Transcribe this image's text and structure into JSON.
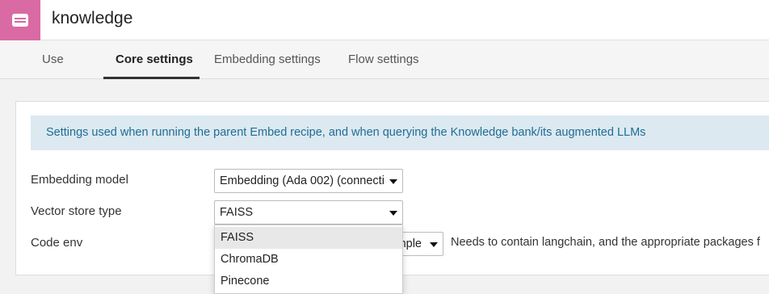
{
  "header": {
    "icon": "dataset-icon",
    "accent_color": "#d96aa4",
    "title": "knowledge"
  },
  "tabs": [
    {
      "label": "Use",
      "active": false
    },
    {
      "label": "Core settings",
      "active": true
    },
    {
      "label": "Embedding settings",
      "active": false
    },
    {
      "label": "Flow settings",
      "active": false
    }
  ],
  "info_banner": "Settings used when running the parent Embed recipe, and when querying the Knowledge bank/its augmented LLMs",
  "form": {
    "embedding_model": {
      "label": "Embedding model",
      "value": "Embedding (Ada 002) (connecti"
    },
    "vector_store_type": {
      "label": "Vector store type",
      "value": "FAISS",
      "options": [
        "FAISS",
        "ChromaDB",
        "Pinecone"
      ],
      "expanded": true
    },
    "code_env": {
      "label": "Code env",
      "value_visible_fragment": "nple",
      "help": "Needs to contain langchain, and the appropriate packages f"
    }
  }
}
